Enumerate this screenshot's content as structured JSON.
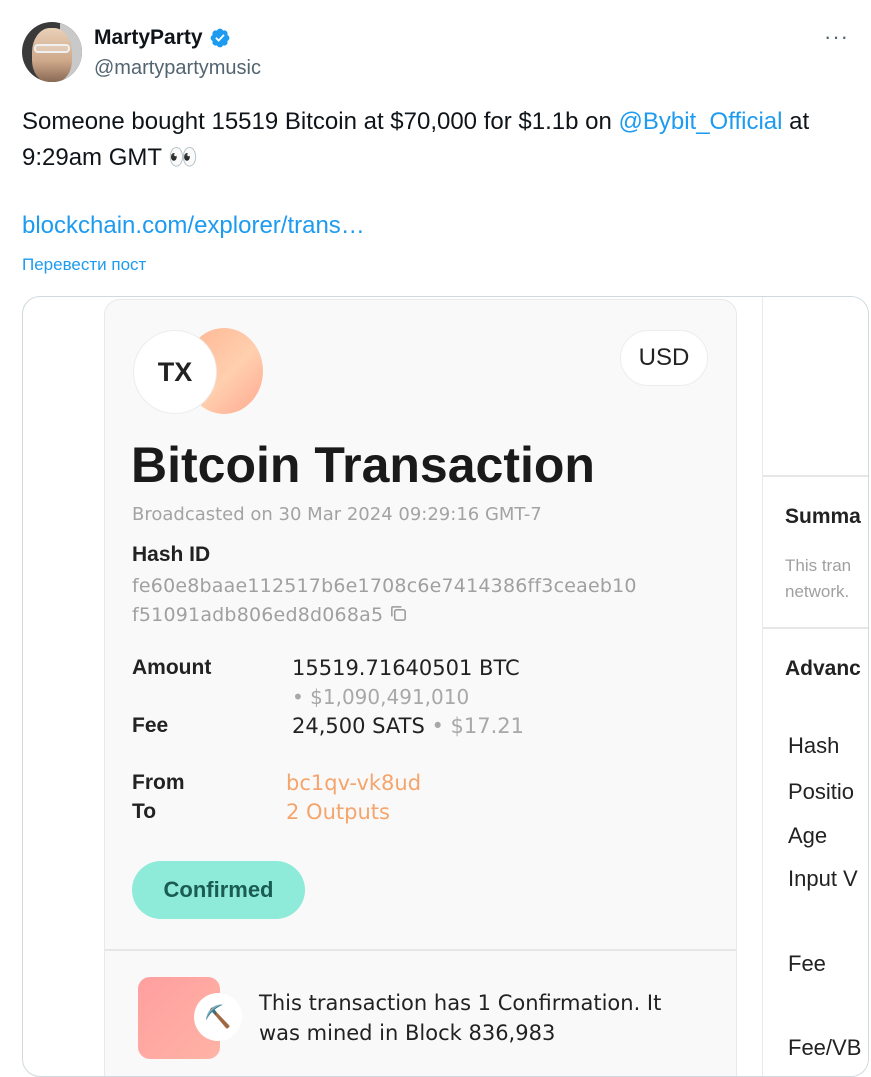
{
  "author": {
    "display_name": "MartyParty",
    "handle": "@martypartymusic",
    "more": "···"
  },
  "tweet": {
    "text_before": "Someone bought 15519 Bitcoin at $70,000 for $1.1b on ",
    "mention": "@Bybit_Official",
    "text_after": " at 9:29am GMT 👀",
    "link": "blockchain.com/explorer/trans…",
    "translate": "Перевести пост"
  },
  "transaction": {
    "badge": "TX",
    "currency_button": "USD",
    "title": "Bitcoin Transaction",
    "broadcast": "Broadcasted on 30 Mar 2024 09:29:16 GMT-7",
    "hash_label": "Hash ID",
    "hash_line1": "fe60e8baae112517b6e1708c6e7414386ff3ceaeb10",
    "hash_line2": "f51091adb806ed8d068a5",
    "amount_label": "Amount",
    "amount_value": "15519.71640501 BTC",
    "amount_usd": "• $1,090,491,010",
    "fee_label": "Fee",
    "fee_value": "24,500 SATS",
    "fee_usd": " • $17.21",
    "from_label": "From",
    "from_value": "bc1qv-vk8ud",
    "to_label": "To",
    "to_value": "2 Outputs",
    "status": "Confirmed",
    "mined_text": "This transaction has 1 Confirmation. It was mined in Block 836,983",
    "pick_glyph": "⛏️"
  },
  "right_panel": {
    "summary_title": "Summa",
    "summary_line1": "This tran",
    "summary_line2": "network.",
    "advanced_title": "Advanc",
    "labels": [
      "Hash",
      "Positio",
      "Age",
      "Input V",
      "Fee",
      "Fee/VB"
    ]
  }
}
